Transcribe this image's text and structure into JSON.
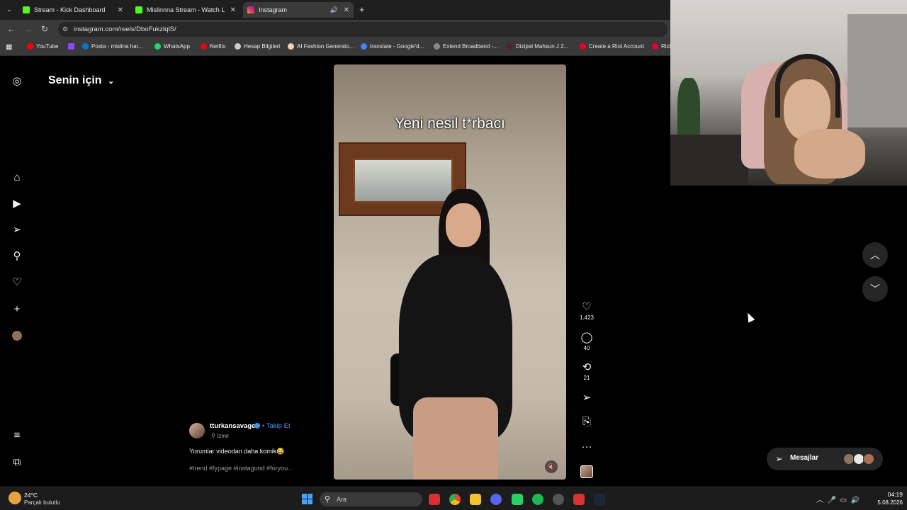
{
  "browser": {
    "tabs": [
      {
        "label": "Stream - Kick Dashboard",
        "color": "#53fc18",
        "active": false
      },
      {
        "label": "Mislinnna Stream - Watch Live o...",
        "color": "#53fc18",
        "active": false
      },
      {
        "label": "Instagram",
        "color": "#e1306c",
        "active": true
      }
    ],
    "url": "instagram.com/reels/DboFukzlqlS/",
    "bookmarks": [
      {
        "label": "YouTube",
        "color": "#ff0000"
      },
      {
        "label": "",
        "color": "#9146ff"
      },
      {
        "label": "Posta - mislina har...",
        "color": "#0078d4"
      },
      {
        "label": "WhatsApp",
        "color": "#25d366"
      },
      {
        "label": "Netflix",
        "color": "#e50914"
      },
      {
        "label": "Hesap Bilgileri",
        "color": "#cccccc"
      },
      {
        "label": "AI Fashion Generato...",
        "color": "#f0d0b0"
      },
      {
        "label": "translate - Google'd...",
        "color": "#4285f4"
      },
      {
        "label": "Extend Broadband -...",
        "color": "#888888"
      },
      {
        "label": "Dizipal Mahsun J 2...",
        "color": "#552222"
      },
      {
        "label": "Create a Riot Account",
        "color": "#eb0029"
      },
      {
        "label": "Rick",
        "color": "#eb0029"
      }
    ]
  },
  "instagram": {
    "feed_title": "Senin için",
    "video_overlay_text": "Yeni nesil t*rbacı",
    "actions": {
      "likes": "1.423",
      "comments": "40",
      "reposts": "21"
    },
    "author": {
      "username": "tturkansavage",
      "follow_label": "Takip Et",
      "location": "İzmir"
    },
    "caption": "Yorumlar videodan daha komik😂",
    "tags": "#trend #fypage #instagood #foryou...",
    "messages_label": "Mesajlar"
  },
  "taskbar": {
    "weather_temp": "24°C",
    "weather_desc": "Parçalı bulutlu",
    "search_placeholder": "Ara",
    "time": "04:19",
    "date": "5.08.2026"
  }
}
